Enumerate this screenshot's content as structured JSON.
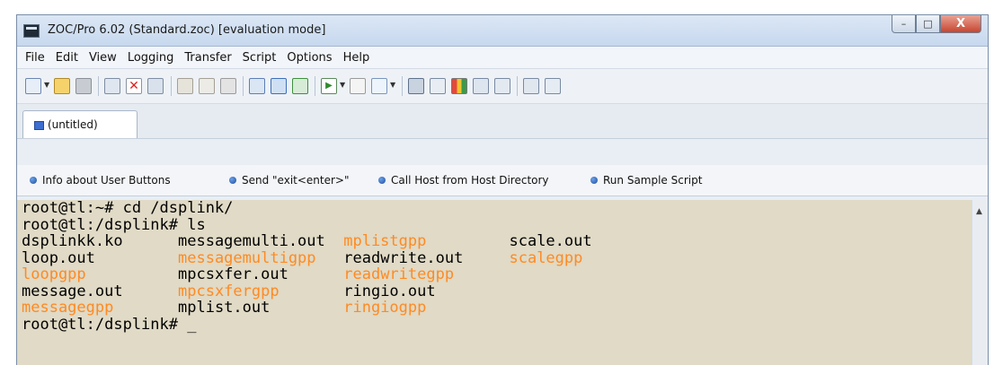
{
  "window": {
    "title": "ZOC/Pro 6.02 (Standard.zoc) [evaluation mode]",
    "controls": {
      "minimize": "–",
      "maximize": "□",
      "close": "X"
    }
  },
  "menu": [
    "File",
    "Edit",
    "View",
    "Logging",
    "Transfer",
    "Script",
    "Options",
    "Help"
  ],
  "toolbar_icons": [
    "connect-icon",
    "favorites-icon",
    "quick-connect-icon",
    "new-window-icon",
    "close-session-icon",
    "clipboard-icon",
    "paste-icon",
    "copy-icon",
    "print-icon",
    "send-file-icon",
    "upload-icon",
    "download-icon",
    "run-script-icon",
    "stop-icon",
    "edit-icon",
    "host-directory-icon",
    "find-icon",
    "chart-icon",
    "options-icon",
    "colors-icon",
    "tools-icon",
    "settings-icon"
  ],
  "tab": {
    "label": "(untitled)"
  },
  "user_buttons": [
    {
      "label": "Info about User Buttons"
    },
    {
      "label": "Send \"exit<enter>\""
    },
    {
      "label": "Call Host from Host Directory"
    },
    {
      "label": "Run Sample Script"
    }
  ],
  "terminal": {
    "lines": [
      [
        {
          "t": "root@tl:~# cd /dsplink/",
          "c": "default"
        }
      ],
      [
        {
          "t": "root@tl:/dsplink# ls",
          "c": "default"
        }
      ],
      [
        {
          "t": "dsplinkk.ko      ",
          "c": "default"
        },
        {
          "t": "messagemulti.out  ",
          "c": "default"
        },
        {
          "t": "mplistgpp",
          "c": "orange"
        },
        {
          "t": "         ",
          "c": "default"
        },
        {
          "t": "scale.out",
          "c": "default"
        }
      ],
      [
        {
          "t": "loop.out         ",
          "c": "default"
        },
        {
          "t": "messagemultigpp",
          "c": "orange"
        },
        {
          "t": "   ",
          "c": "default"
        },
        {
          "t": "readwrite.out     ",
          "c": "default"
        },
        {
          "t": "scalegpp",
          "c": "orange"
        }
      ],
      [
        {
          "t": "loopgpp",
          "c": "orange"
        },
        {
          "t": "          ",
          "c": "default"
        },
        {
          "t": "mpcsxfer.out      ",
          "c": "default"
        },
        {
          "t": "readwritegpp",
          "c": "orange"
        }
      ],
      [
        {
          "t": "message.out      ",
          "c": "default"
        },
        {
          "t": "mpcsxfergpp",
          "c": "orange"
        },
        {
          "t": "       ",
          "c": "default"
        },
        {
          "t": "ringio.out",
          "c": "default"
        }
      ],
      [
        {
          "t": "messagegpp",
          "c": "orange"
        },
        {
          "t": "       ",
          "c": "default"
        },
        {
          "t": "mplist.out        ",
          "c": "default"
        },
        {
          "t": "ringiogpp",
          "c": "orange"
        }
      ],
      [
        {
          "t": "root@tl:/dsplink# _",
          "c": "default"
        }
      ]
    ]
  },
  "colors": {
    "terminal_bg": "#e0dac6",
    "highlight_text": "#ff8a22",
    "default_text": "#000000"
  }
}
